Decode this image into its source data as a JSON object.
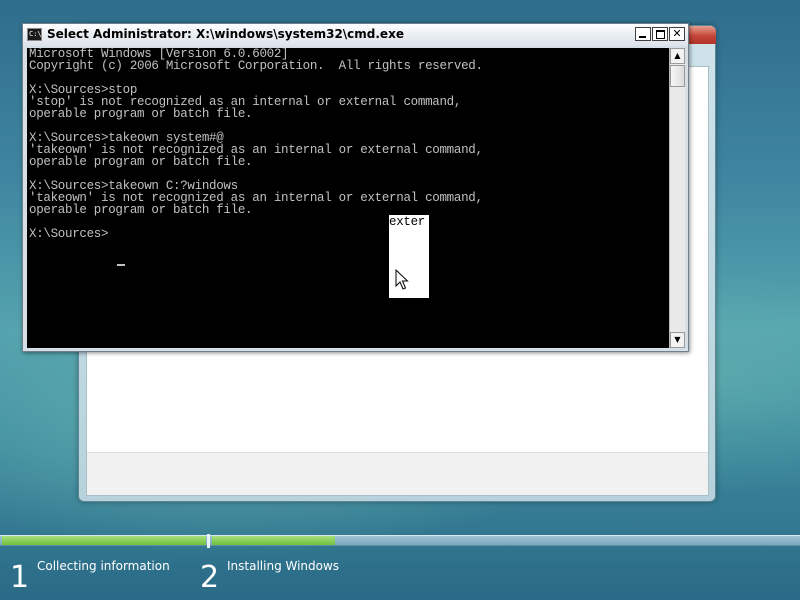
{
  "cmd_window": {
    "title": "Select Administrator: X:\\windows\\system32\\cmd.exe",
    "icon_text": "C:\\",
    "buttons": {
      "minimize": "minimize-icon",
      "maximize": "maximize-icon",
      "close": "✕"
    },
    "lines": [
      "Microsoft Windows [Version 6.0.6002]",
      "Copyright (c) 2006 Microsoft Corporation.  All rights reserved.",
      "",
      "X:\\Sources>stop",
      "'stop' is not recognized as an internal or external command,",
      "operable program or batch file.",
      "",
      "X:\\Sources>takeown system#@",
      "'takeown' is not recognized as an internal or external command,",
      "operable program or batch file.",
      "",
      "X:\\Sources>takeown C:?windows",
      "'takeown' is not recognized as an internal or external command,",
      "operable program or batch file.",
      "",
      "X:\\Sources>"
    ],
    "selected_text": "exter",
    "scrollbar": {
      "up_arrow": "▲",
      "down_arrow": "▼"
    }
  },
  "setup": {
    "progress": {
      "step1_fraction": 1.0,
      "step2_fraction": 0.21
    },
    "steps": [
      {
        "number": "1",
        "label": "Collecting information"
      },
      {
        "number": "2",
        "label": "Installing Windows"
      }
    ]
  },
  "colors": {
    "console_background": "#000000",
    "console_text": "#c0c0c0",
    "progress_fill": "#6fbf3d"
  }
}
